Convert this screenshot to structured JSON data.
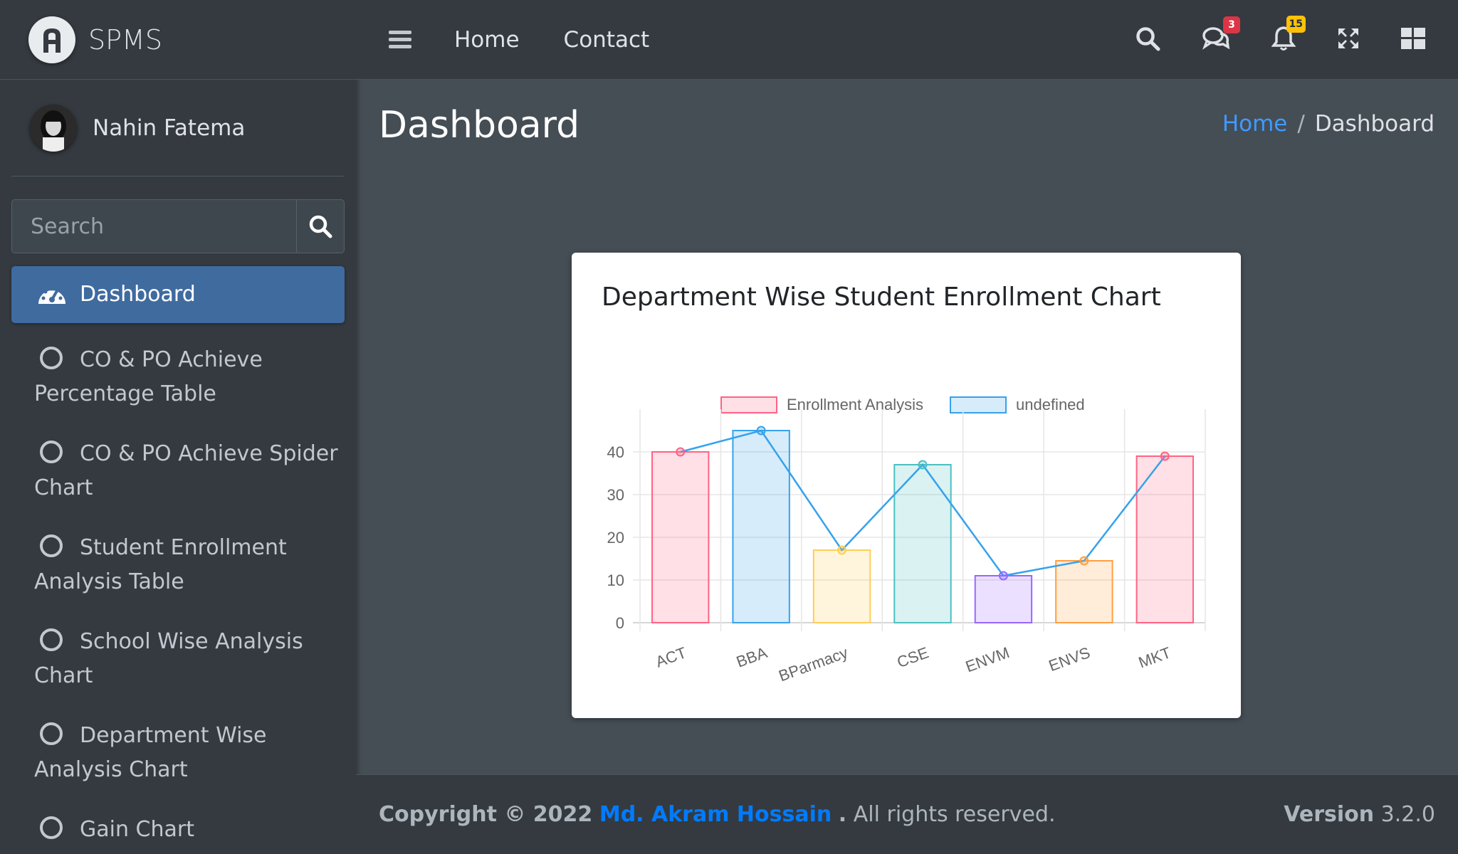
{
  "brand": {
    "name": "SPMS",
    "logo_icon": "a-logo-icon"
  },
  "user": {
    "name": "Nahin Fatema"
  },
  "search": {
    "placeholder": "Search"
  },
  "nav": {
    "active": {
      "label": "Dashboard",
      "icon": "tachometer-icon"
    },
    "items": [
      {
        "line1": "CO & PO Achieve",
        "line2": "Percentage Table"
      },
      {
        "line1": "CO & PO Achieve Spider",
        "line2": "Chart"
      },
      {
        "line1": "Student Enrollment",
        "line2": "Analysis Table"
      },
      {
        "line1": "School Wise Analysis",
        "line2": "Chart"
      },
      {
        "line1": "Department Wise",
        "line2": "Analysis Chart"
      },
      {
        "line1": "Gain Chart",
        "line2": ""
      }
    ]
  },
  "topbar": {
    "links": [
      "Home",
      "Contact"
    ],
    "messages_badge": "3",
    "notifications_badge": "15"
  },
  "page": {
    "title": "Dashboard"
  },
  "breadcrumb": {
    "home": "Home",
    "sep": "/",
    "current": "Dashboard"
  },
  "card": {
    "title": "Department Wise Student Enrollment Chart"
  },
  "chart_data": {
    "type": "bar",
    "categories": [
      "ACT",
      "BBA",
      "BParmacy",
      "CSE",
      "ENVM",
      "ENVS",
      "MKT"
    ],
    "series": [
      {
        "name": "Enrollment Analysis",
        "type": "bar",
        "values": [
          40,
          45,
          17,
          37,
          11,
          14.5,
          39
        ]
      },
      {
        "name": "undefined",
        "type": "line",
        "values": [
          40,
          45,
          17,
          37,
          11,
          14.5,
          39
        ]
      }
    ],
    "ylim": [
      0,
      45
    ],
    "yticks": [
      0,
      10,
      20,
      30,
      40
    ],
    "grid": true,
    "legend": "top",
    "bar_colors": [
      "#ff6384",
      "#36a2eb",
      "#ffce56",
      "#4bc0c0",
      "#9966ff",
      "#ff9f40",
      "#ff6384"
    ],
    "line_color": "#36a2eb"
  },
  "footer": {
    "copyright": "Copyright © 2022",
    "author": "Md. Akram Hossain",
    "dot": ".",
    "rights": "All rights reserved.",
    "version_label": "Version",
    "version": "3.2.0"
  }
}
